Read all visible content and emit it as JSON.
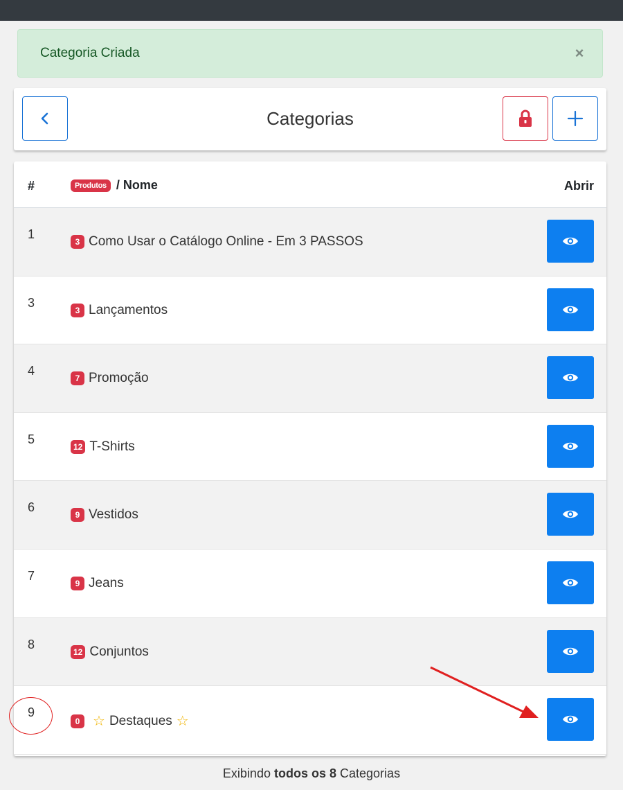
{
  "alert": {
    "message": "Categoria Criada",
    "close": "×"
  },
  "header": {
    "title": "Categorias",
    "add_label": "+"
  },
  "table": {
    "col_num": "#",
    "col_badge": "Produtos",
    "col_name": "/ Nome",
    "col_open": "Abrir",
    "rows": [
      {
        "num": "1",
        "count": "3",
        "name": "Como Usar o Catálogo Online - Em 3 PASSOS"
      },
      {
        "num": "3",
        "count": "3",
        "name": "Lançamentos"
      },
      {
        "num": "4",
        "count": "7",
        "name": "Promoção"
      },
      {
        "num": "5",
        "count": "12",
        "name": "T-Shirts"
      },
      {
        "num": "6",
        "count": "9",
        "name": "Vestidos"
      },
      {
        "num": "7",
        "count": "9",
        "name": "Jeans"
      },
      {
        "num": "8",
        "count": "12",
        "name": "Conjuntos"
      },
      {
        "num": "9",
        "count": "0",
        "name": "Destaques",
        "star": "☆"
      }
    ]
  },
  "footer": {
    "prefix": "Exibindo",
    "bold": "todos os 8",
    "suffix": "Categorias"
  },
  "colors": {
    "primary": "#0d7ff0",
    "danger": "#d93447",
    "success_bg": "#d4edda"
  },
  "icons": {
    "back": "chevron-left-icon",
    "lock": "lock-icon",
    "add": "plus-icon",
    "view": "eye-icon"
  }
}
